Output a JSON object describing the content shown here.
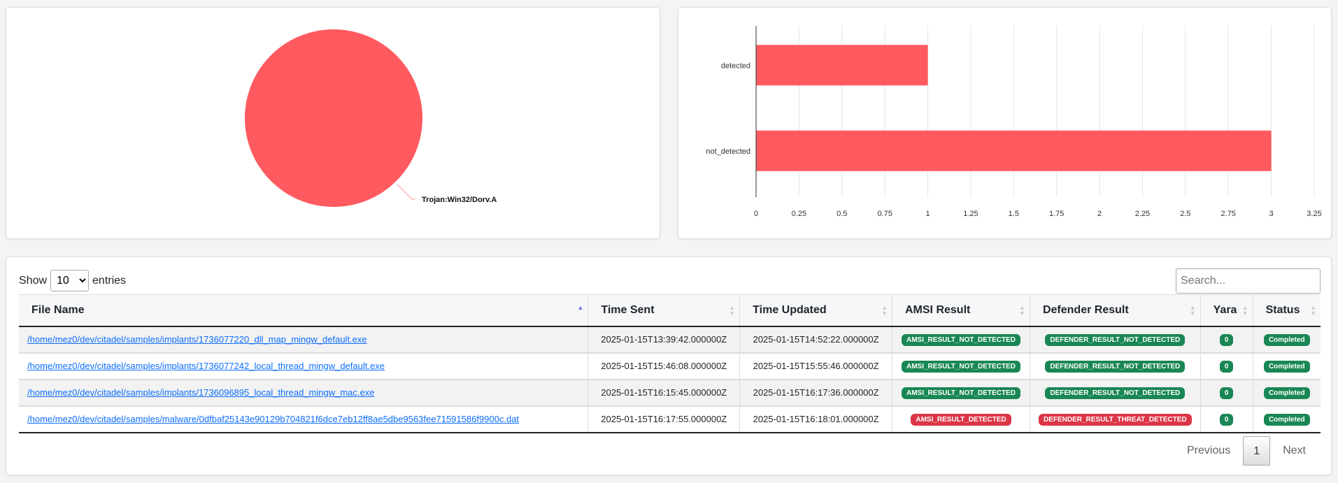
{
  "chart_data": [
    {
      "type": "pie",
      "slices": [
        {
          "label": "Trojan:Win32/Dorv.A",
          "value": 1
        }
      ],
      "colors": [
        "#ff5a5f"
      ]
    },
    {
      "type": "bar",
      "orientation": "horizontal",
      "categories": [
        "detected",
        "not_detected"
      ],
      "values": [
        1,
        3
      ],
      "xlim": [
        0,
        3.25
      ],
      "x_ticks": [
        "0",
        "0.25",
        "0.5",
        "0.75",
        "1",
        "1.25",
        "1.5",
        "1.75",
        "2",
        "2.25",
        "2.5",
        "2.75",
        "3",
        "3.25"
      ],
      "grid": true,
      "color": "#ff5a5f"
    }
  ],
  "table": {
    "length_prefix": "Show",
    "length_value": "10",
    "length_suffix": "entries",
    "search_placeholder": "Search...",
    "columns": [
      "File Name",
      "Time Sent",
      "Time Updated",
      "AMSI Result",
      "Defender Result",
      "Yara",
      "Status"
    ],
    "rows": [
      {
        "file": "/home/mez0/dev/citadel/samples/implants/1736077220_dll_map_mingw_default.exe",
        "sent": "2025-01-15T13:39:42.000000Z",
        "updated": "2025-01-15T14:52:22.000000Z",
        "amsi": "AMSI_RESULT_NOT_DETECTED",
        "defender": "DEFENDER_RESULT_NOT_DETECTED",
        "yara": "0",
        "status": "Completed"
      },
      {
        "file": "/home/mez0/dev/citadel/samples/implants/1736077242_local_thread_mingw_default.exe",
        "sent": "2025-01-15T15:46:08.000000Z",
        "updated": "2025-01-15T15:55:46.000000Z",
        "amsi": "AMSI_RESULT_NOT_DETECTED",
        "defender": "DEFENDER_RESULT_NOT_DETECTED",
        "yara": "0",
        "status": "Completed"
      },
      {
        "file": "/home/mez0/dev/citadel/samples/implants/1736096895_local_thread_mingw_mac.exe",
        "sent": "2025-01-15T16:15:45.000000Z",
        "updated": "2025-01-15T16:17:36.000000Z",
        "amsi": "AMSI_RESULT_NOT_DETECTED",
        "defender": "DEFENDER_RESULT_NOT_DETECTED",
        "yara": "0",
        "status": "Completed"
      },
      {
        "file": "/home/mez0/dev/citadel/samples/malware/0dfbaf25143e90129b704821f6dce7eb12ff8ae5dbe9563fee71591586f9900c.dat",
        "sent": "2025-01-15T16:17:55.000000Z",
        "updated": "2025-01-15T16:18:01.000000Z",
        "amsi": "AMSI_RESULT_DETECTED",
        "defender": "DEFENDER_RESULT_THREAT_DETECTED",
        "yara": "0",
        "status": "Completed"
      }
    ],
    "pagination": {
      "previous": "Previous",
      "current": "1",
      "next": "Next"
    }
  }
}
